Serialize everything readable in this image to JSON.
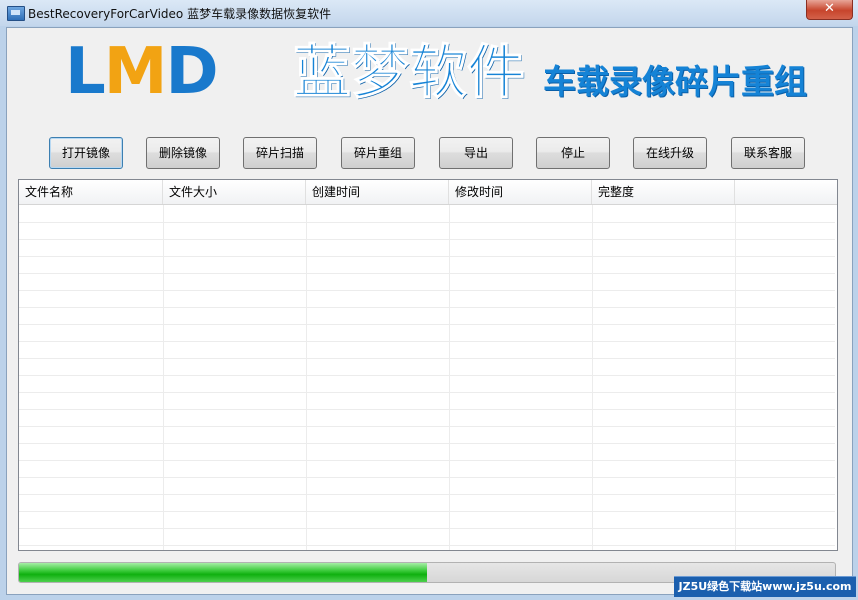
{
  "window": {
    "title": "BestRecoveryForCarVideo  蓝梦车载录像数据恢复软件",
    "close_glyph": "✕"
  },
  "banner": {
    "logo": [
      "L",
      "M",
      "D"
    ],
    "brand_name": "蓝梦软件",
    "subtitle": "车载录像碎片重组"
  },
  "toolbar": {
    "buttons": [
      {
        "label": "打开镜像"
      },
      {
        "label": "删除镜像"
      },
      {
        "label": "碎片扫描"
      },
      {
        "label": "碎片重组"
      },
      {
        "label": "导出"
      },
      {
        "label": "停止"
      },
      {
        "label": "在线升级"
      },
      {
        "label": "联系客服"
      }
    ]
  },
  "file_list": {
    "columns": [
      "文件名称",
      "文件大小",
      "创建时间",
      "修改时间",
      "完整度",
      ""
    ],
    "rows": []
  },
  "progress": {
    "value": 0.5
  },
  "watermark": "JZ5U绿色下载站www.jz5u.com",
  "colors": {
    "logo_blue": "#1979cc",
    "logo_orange": "#f2a313",
    "brand_blue": "#1583d6",
    "progress_green": "#0fb00f"
  },
  "icons": {
    "app": "app-window-icon",
    "close": "close-icon"
  }
}
